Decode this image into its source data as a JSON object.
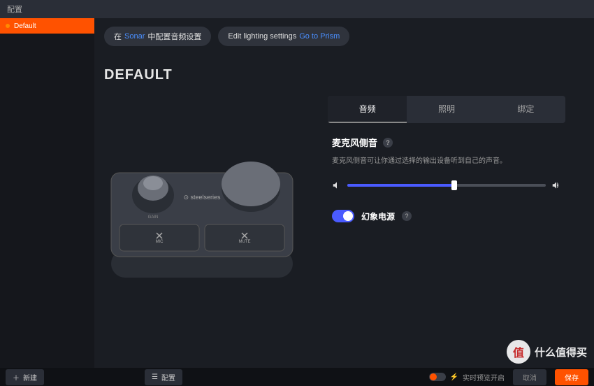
{
  "topbar": {
    "title": "配置"
  },
  "sidebar": {
    "items": [
      {
        "label": "Default"
      }
    ]
  },
  "actions": {
    "sonar_prefix": "在",
    "sonar_link": "Sonar",
    "sonar_suffix": "中配置音频设置",
    "lighting": "Edit lighting settings",
    "prism": "Go to Prism"
  },
  "title": "DEFAULT",
  "tabs": {
    "audio": "音频",
    "lighting": "照明",
    "binding": "绑定"
  },
  "sidetone": {
    "title": "麦克风侧音",
    "help": "?",
    "desc": "麦克风侧音可让你通过选择的输出设备听到自己的声音。"
  },
  "phantom": {
    "label": "幻象电源",
    "help": "?"
  },
  "device": {
    "brand": "steelseries",
    "gain": "GAIN",
    "mic": "MIC",
    "mute": "MUTE"
  },
  "bottom": {
    "new": "新建",
    "config": "配置",
    "preview": "实时预览开启",
    "cancel": "取消",
    "save": "保存"
  },
  "watermark": {
    "char": "值",
    "text": "什么值得买"
  }
}
